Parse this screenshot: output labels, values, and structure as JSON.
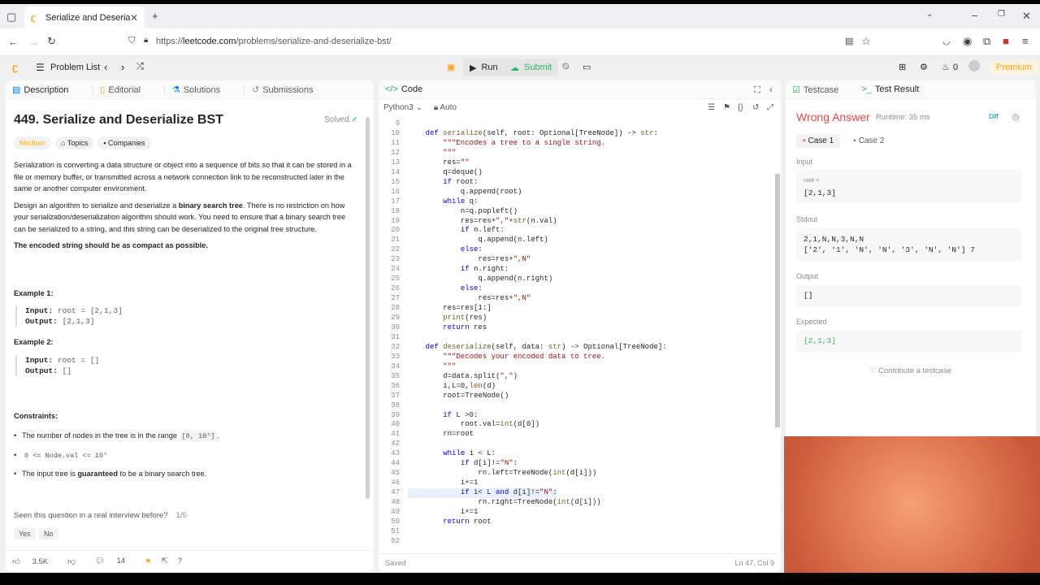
{
  "browser": {
    "tab_title": "Serialize and Deserialize BST - L",
    "url_prefix": "https://",
    "url_host": "leetcode.com",
    "url_path": "/problems/serialize-and-deserialize-bst/"
  },
  "nav": {
    "problem_list": "Problem List",
    "run": "Run",
    "submit": "Submit",
    "fire_count": "0",
    "premium": "Premium"
  },
  "desc_tabs": [
    "Description",
    "Editorial",
    "Solutions",
    "Submissions"
  ],
  "problem": {
    "title": "449. Serialize and Deserialize BST",
    "solved": "Solved",
    "difficulty": "Medium",
    "topics": "Topics",
    "companies": "Companies",
    "p1": "Serialization is converting a data structure or object into a sequence of bits so that it can be stored in a file or memory buffer, or transmitted across a network connection link to be reconstructed later in the same or another computer environment.",
    "p2_a": "Design an algorithm to serialize and deserialize a ",
    "p2_b": "binary search tree",
    "p2_c": ". There is no restriction on how your serialization/deserialization algorithm should work. You need to ensure that a binary search tree can be serialized to a string, and this string can be deserialized to the original tree structure.",
    "p3": "The encoded string should be as compact as possible.",
    "ex1_title": "Example 1:",
    "ex1_input_label": "Input:",
    "ex1_input": "root = [2,1,3]",
    "ex1_output_label": "Output:",
    "ex1_output": "[2,1,3]",
    "ex2_title": "Example 2:",
    "ex2_input_label": "Input:",
    "ex2_input": "root = []",
    "ex2_output_label": "Output:",
    "ex2_output": "[]",
    "constraints_title": "Constraints:",
    "c1_a": "The number of nodes in the tree is in the range ",
    "c1_b": "[0, 10⁴]",
    "c1_c": ".",
    "c2": "0 <= Node.val <= 10⁴",
    "c3_a": "The input tree is ",
    "c3_b": "guaranteed",
    "c3_c": " to be a binary search tree.",
    "seen": "Seen this question in a real interview before?",
    "seen_frac": "1/5",
    "yes": "Yes",
    "no": "No",
    "likes": "3.5K",
    "comments": "14"
  },
  "code": {
    "tab": "Code",
    "language": "Python3",
    "mode": "Auto",
    "status_left": "Saved",
    "status_right": "Ln 47, Col 9",
    "lines": [
      {
        "n": "9",
        "t": ""
      },
      {
        "n": "10",
        "t": "    def serialize(self, root: Optional[TreeNode]) -> str:"
      },
      {
        "n": "11",
        "t": "        \"\"\"Encodes a tree to a single string."
      },
      {
        "n": "12",
        "t": "        \"\"\""
      },
      {
        "n": "13",
        "t": "        res=\"\""
      },
      {
        "n": "14",
        "t": "        q=deque()"
      },
      {
        "n": "15",
        "t": "        if root:"
      },
      {
        "n": "16",
        "t": "            q.append(root)"
      },
      {
        "n": "17",
        "t": "        while q:"
      },
      {
        "n": "18",
        "t": "            n=q.popleft()"
      },
      {
        "n": "19",
        "t": "            res=res+\",\"+str(n.val)"
      },
      {
        "n": "20",
        "t": "            if n.left:"
      },
      {
        "n": "21",
        "t": "                q.append(n.left)"
      },
      {
        "n": "22",
        "t": "            else:"
      },
      {
        "n": "23",
        "t": "                res=res+\",N\""
      },
      {
        "n": "24",
        "t": "            if n.right:"
      },
      {
        "n": "25",
        "t": "                q.append(n.right)"
      },
      {
        "n": "26",
        "t": "            else:"
      },
      {
        "n": "27",
        "t": "                res=res+\",N\""
      },
      {
        "n": "28",
        "t": "        res=res[1:]"
      },
      {
        "n": "29",
        "t": "        print(res)"
      },
      {
        "n": "30",
        "t": "        return res"
      },
      {
        "n": "31",
        "t": ""
      },
      {
        "n": "32",
        "t": "    def deserialize(self, data: str) -> Optional[TreeNode]:"
      },
      {
        "n": "33",
        "t": "        \"\"\"Decodes your encoded data to tree."
      },
      {
        "n": "34",
        "t": "        \"\"\""
      },
      {
        "n": "35",
        "t": "        d=data.split(\",\")"
      },
      {
        "n": "36",
        "t": "        i,L=0,len(d)"
      },
      {
        "n": "37",
        "t": "        root=TreeNode()"
      },
      {
        "n": "38",
        "t": ""
      },
      {
        "n": "39",
        "t": "        if L >0:"
      },
      {
        "n": "40",
        "t": "            root.val=int(d[0])"
      },
      {
        "n": "41",
        "t": "        rn=root"
      },
      {
        "n": "42",
        "t": ""
      },
      {
        "n": "43",
        "t": "        while i < L:"
      },
      {
        "n": "44",
        "t": "            if d[i]!=\"N\":"
      },
      {
        "n": "45",
        "t": "                rn.left=TreeNode(int(d[i]))"
      },
      {
        "n": "46",
        "t": "            i+=1"
      },
      {
        "n": "47",
        "t": "            if i< L and d[i]!=\"N\":"
      },
      {
        "n": "48",
        "t": "                rn.right=TreeNode(int(d[i]))"
      },
      {
        "n": "49",
        "t": "            i+=1"
      },
      {
        "n": "50",
        "t": "        return root"
      },
      {
        "n": "51",
        "t": ""
      },
      {
        "n": "52",
        "t": ""
      }
    ]
  },
  "result": {
    "tab_testcase": "Testcase",
    "tab_result": "Test Result",
    "verdict": "Wrong Answer",
    "runtime": "Runtime: 35 ms",
    "diff": "Diff",
    "case1": "Case 1",
    "case2": "Case 2",
    "input_label": "Input",
    "input_var": "root =",
    "input_val": "[2,1,3]",
    "stdout_label": "Stdout",
    "stdout_1": "2,1,N,N,3,N,N",
    "stdout_2": "['2', '1', 'N', 'N', '3', 'N', 'N'] 7",
    "output_label": "Output",
    "output_val": "[]",
    "expected_label": "Expected",
    "expected_val": "[2,1,3]",
    "contribute": "Contribute a testcase"
  },
  "colors": {
    "accent": "#ffa116",
    "wrong": "#ef4743",
    "accepted": "#2db55d"
  }
}
